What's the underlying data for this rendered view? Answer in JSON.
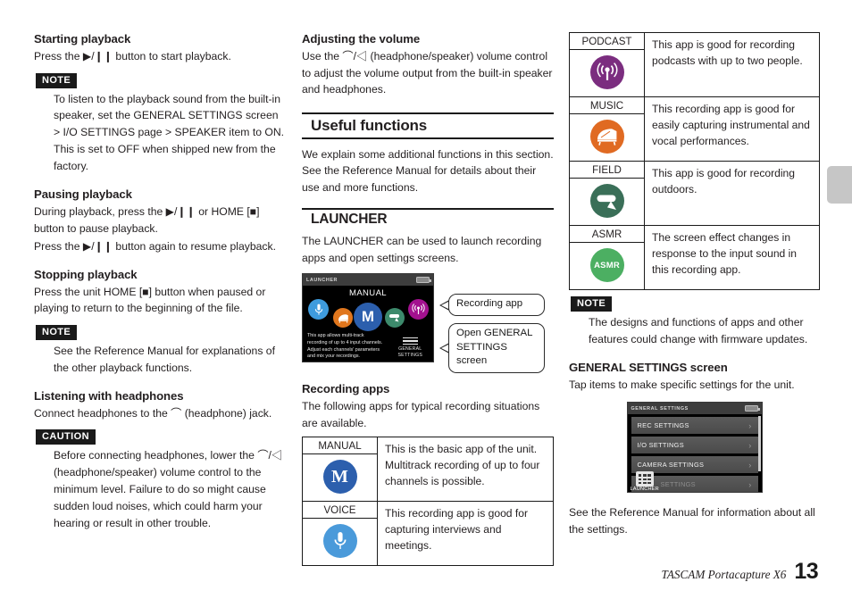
{
  "left": {
    "h_starting": "Starting playback",
    "p_starting": "Press the ▶/❙❙ button to start playback.",
    "note1_tag": "NOTE",
    "note1_body": "To listen to the playback sound from the built-in speaker, set the GENERAL SETTINGS screen > I/O SETTINGS page > SPEAKER  item to ON. This is set to OFF when shipped new from the factory.",
    "h_pausing": "Pausing playback",
    "p_pausing1": "During playback, press the ▶/❙❙ or HOME [■] button to pause playback.",
    "p_pausing2": "Press the ▶/❙❙ button again to resume playback.",
    "h_stopping": "Stopping playback",
    "p_stopping": "Press the unit HOME [■] button when paused or playing to return to the beginning of the file.",
    "note2_tag": "NOTE",
    "note2_body": "See the Reference Manual for explanations of the other playback functions.",
    "h_headphones": "Listening with headphones",
    "p_headphones": "Connect headphones to the ⌒ (headphone) jack.",
    "caution_tag": "CAUTION",
    "caution_body": "Before connecting headphones, lower the ⌒/◁ (headphone/speaker) volume control to the minimum level. Failure to do so might cause sudden loud noises, which could harm your hearing or result in other trouble."
  },
  "mid": {
    "h_volume": "Adjusting the volume",
    "p_volume": "Use the ⌒/◁ (headphone/speaker) volume control to adjust the volume output from the built-in speaker and headphones.",
    "sect_useful": "Useful functions",
    "p_useful": "We explain some additional functions in this section. See the Reference Manual for details about their use and more functions.",
    "sect_launcher": "LAUNCHER",
    "p_launcher": "The LAUNCHER can be used to launch recording apps and open settings screens.",
    "launcher_shot": {
      "titlebar": "LAUNCHER",
      "app_title": "MANUAL",
      "description": "This app allows multi-track recording of up to 4 input channels. Adjust each channels' parameters and mix your recordings.",
      "gs_label_1": "GENERAL",
      "gs_label_2": "SETTINGS",
      "icons": [
        {
          "name": "voice-app-icon",
          "color": "#3e9bdd",
          "glyph": "mic"
        },
        {
          "name": "music-app-icon",
          "color": "#e0761d",
          "glyph": "piano"
        },
        {
          "name": "manual-app-icon",
          "color": "#2c5fad",
          "glyph": "M"
        },
        {
          "name": "field-app-icon",
          "color": "#3d8a6c",
          "glyph": "windscreen"
        },
        {
          "name": "podcast-app-icon",
          "color": "#a3118f",
          "glyph": "podcast"
        }
      ]
    },
    "callout_recording_app": "Recording app",
    "callout_general_settings": "Open GENERAL SETTINGS screen",
    "h_recording_apps": "Recording apps",
    "p_recording_apps": "The following apps for typical recording situations are available.",
    "apps": [
      {
        "name": "MANUAL",
        "icon_color": "#2c5fad",
        "icon_glyph": "M",
        "desc": "This is the basic app of the unit. Multitrack recording of up to four channels is possible."
      },
      {
        "name": "VOICE",
        "icon_color": "#4a9ada",
        "icon_glyph": "mic",
        "desc": "This recording app is good for capturing interviews and meetings."
      }
    ]
  },
  "right": {
    "apps": [
      {
        "name": "PODCAST",
        "icon_color": "#7b2d7f",
        "icon_glyph": "podcast",
        "desc": "This app is good for recording podcasts with up to two people."
      },
      {
        "name": "MUSIC",
        "icon_color": "#e06a22",
        "icon_glyph": "piano",
        "desc": "This recording app is good for easily capturing instrumental and vocal performances."
      },
      {
        "name": "FIELD",
        "icon_color": "#3a6f58",
        "icon_glyph": "windscreen",
        "desc": "This app is good for recording outdoors."
      },
      {
        "name": "ASMR",
        "icon_color": "#4caf62",
        "icon_glyph": "ASMR",
        "desc": "The screen effect changes in response to the input sound in this recording app."
      }
    ],
    "note_tag": "NOTE",
    "note_body": "The designs and functions of apps and other features could change with firmware updates.",
    "h_general_settings": "GENERAL SETTINGS screen",
    "p_general_settings": "Tap items to make specific settings for the unit.",
    "gs_shot": {
      "titlebar": "GENERAL SETTINGS",
      "rows": [
        {
          "label": "REC SETTINGS",
          "chevron": "›"
        },
        {
          "label": "I/O SETTINGS",
          "chevron": "›"
        },
        {
          "label": "CAMERA SETTINGS",
          "chevron": "›"
        },
        {
          "label": "SETTINGS",
          "chevron": "›"
        }
      ],
      "launcher_badge": "LAUNCHER"
    },
    "p_closing": "See the Reference Manual for information about all the settings."
  },
  "footer": {
    "brand": "TASCAM Portacapture X6",
    "page_number": "13"
  }
}
